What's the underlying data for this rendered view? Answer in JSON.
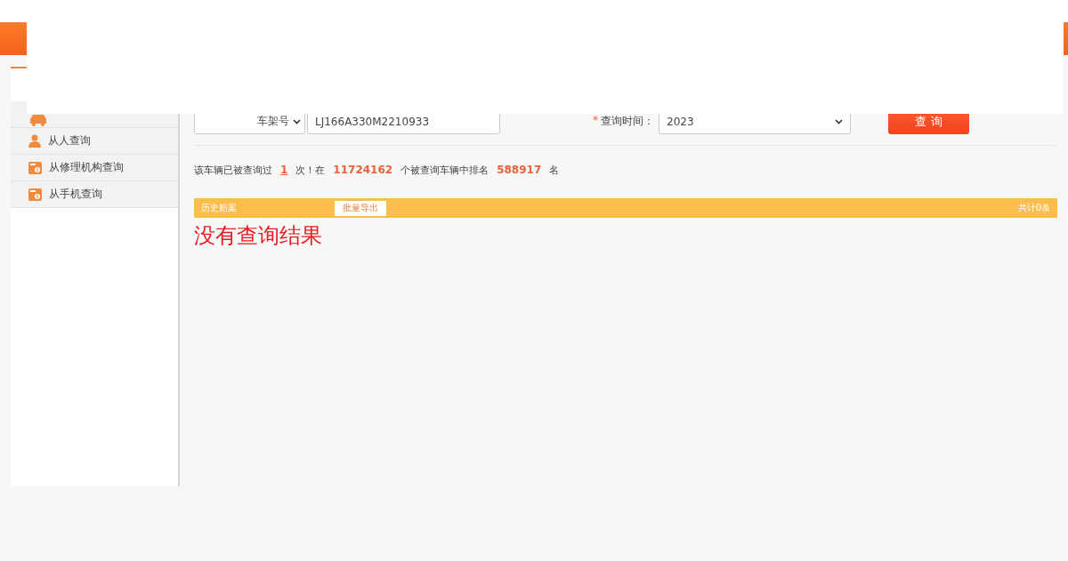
{
  "sidebar": {
    "items": [
      {
        "kind": "car"
      },
      {
        "label": "从人查询",
        "kind": "person"
      },
      {
        "label": "从修理机构查询",
        "kind": "card"
      },
      {
        "label": "从手机查询",
        "kind": "card"
      }
    ]
  },
  "form": {
    "field_type": "车架号",
    "vin": "LJ166A330M2210933",
    "required_mark": "*",
    "time_label": "查询时间：",
    "year": "2023",
    "query_button": "查 询"
  },
  "stats": "该车辆已被查询过**1**次！在**11724162**个被查询车辆中排名**588917**名",
  "results": {
    "title": "历史赔案",
    "export_button": "批量导出",
    "total": "共计0条",
    "empty_message": "没有查询结果"
  }
}
